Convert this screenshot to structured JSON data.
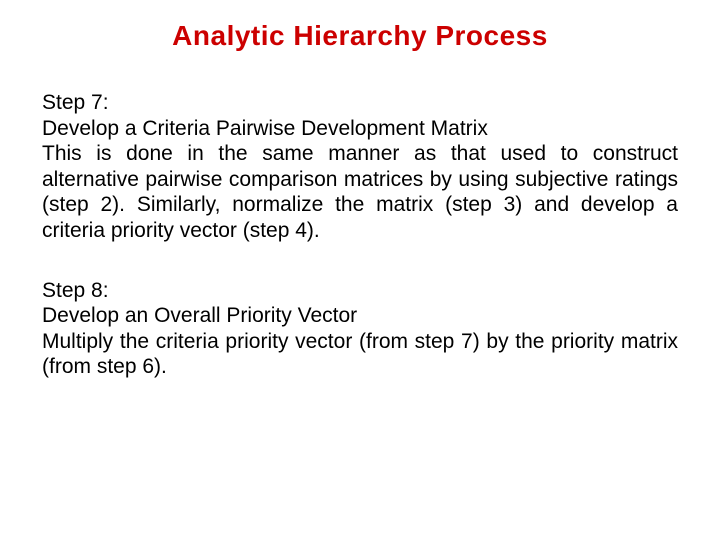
{
  "title": "Analytic Hierarchy Process",
  "step7": {
    "label": "Step 7:",
    "heading": "Develop a Criteria Pairwise Development Matrix",
    "body": "This is done in the same manner as that used to construct alternative pairwise comparison matrices by using subjective ratings (step 2).  Similarly, normalize the matrix (step 3) and develop a criteria priority vector (step 4)."
  },
  "step8": {
    "label": "Step 8:",
    "heading": "Develop an Overall Priority Vector",
    "body": "Multiply the criteria priority vector (from step 7) by the priority matrix (from step 6)."
  }
}
